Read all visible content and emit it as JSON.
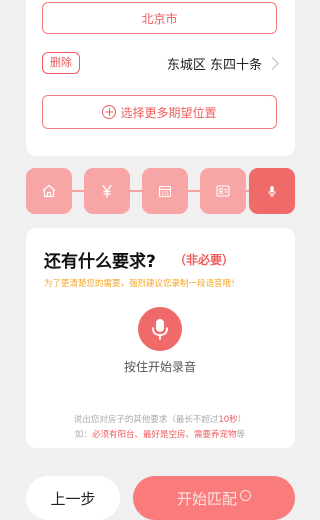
{
  "location": {
    "city": "北京市",
    "delete_label": "删除",
    "district": "东城区 东四十条",
    "more_label": "选择更多期望位置"
  },
  "steps": {
    "icons": [
      "home-icon",
      "yen-icon",
      "calendar-icon",
      "id-card-icon",
      "mic-icon"
    ],
    "active_index": 4
  },
  "question": {
    "title": "还有什么要求?",
    "optional": "（非必要）",
    "tip": "为了更清楚您的需要，强烈建议您录制一段语音哦！",
    "mic_label": "按住开始录音",
    "hint_line1_prefix": "说出您对房子的其他要求（最长不超过",
    "hint_line1_highlight": "10秒",
    "hint_line1_suffix": "）",
    "hint_line2_prefix": "如：",
    "hint_line2_highlight": "必须有阳台、最好是空房、需要养宠物",
    "hint_line2_suffix": "等"
  },
  "footer": {
    "prev_label": "上一步",
    "next_label": "开始匹配"
  },
  "colors": {
    "accent": "#f15c5c",
    "step_inactive": "#f7a5a5",
    "step_active": "#f16a6a",
    "tip": "#f5a623"
  }
}
